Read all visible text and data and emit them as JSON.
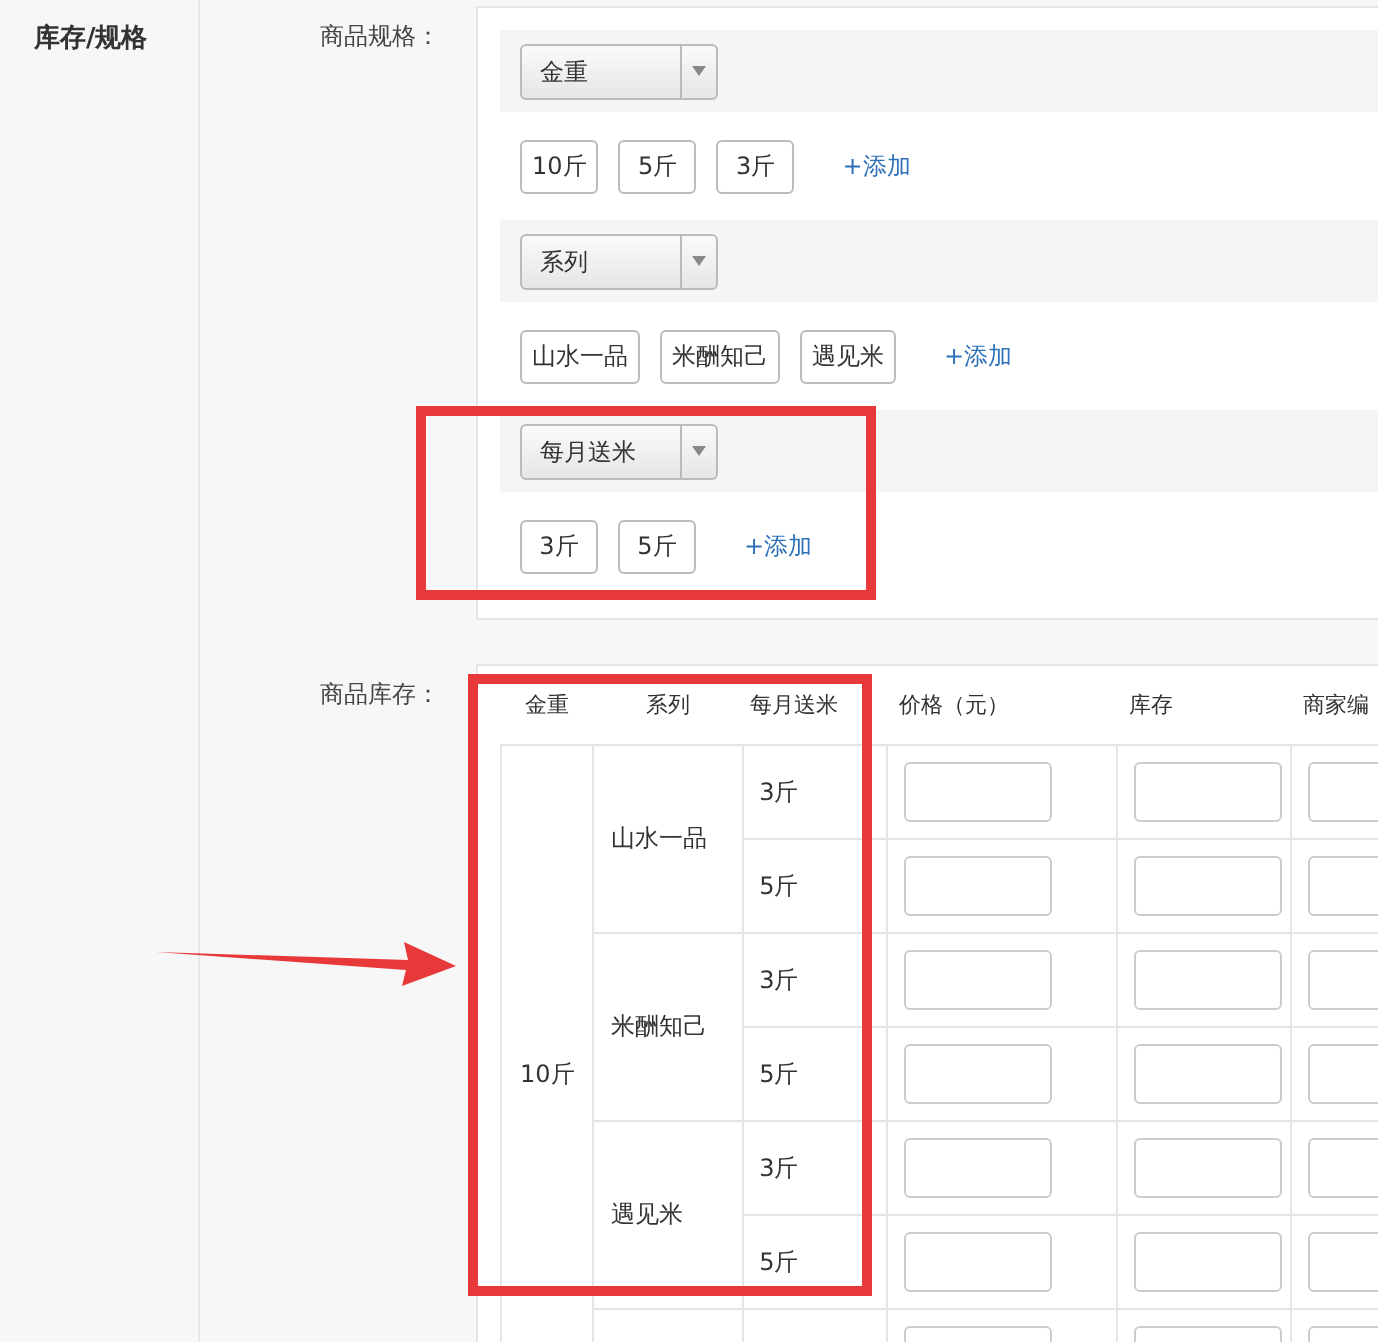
{
  "section_label": "库存/规格",
  "spec_label": "商品规格：",
  "spec_groups": [
    {
      "name": "金重",
      "values": [
        "10斤",
        "5斤",
        "3斤"
      ],
      "add_label": "+添加"
    },
    {
      "name": "系列",
      "values": [
        "山水一品",
        "米酬知己",
        "遇见米"
      ],
      "add_label": "+添加"
    },
    {
      "name": "每月送米",
      "values": [
        "3斤",
        "5斤"
      ],
      "add_label": "+添加"
    }
  ],
  "stock_label": "商品库存：",
  "stock_table": {
    "columns": [
      "金重",
      "系列",
      "每月送米",
      "价格（元）",
      "库存",
      "商家编"
    ],
    "rows": [
      {
        "weight": "10斤",
        "children": [
          {
            "series": "山水一品",
            "children": [
              "3斤",
              "5斤"
            ]
          },
          {
            "series": "米酬知己",
            "children": [
              "3斤",
              "5斤"
            ]
          },
          {
            "series": "遇见米",
            "children": [
              "3斤",
              "5斤"
            ]
          }
        ]
      }
    ]
  }
}
